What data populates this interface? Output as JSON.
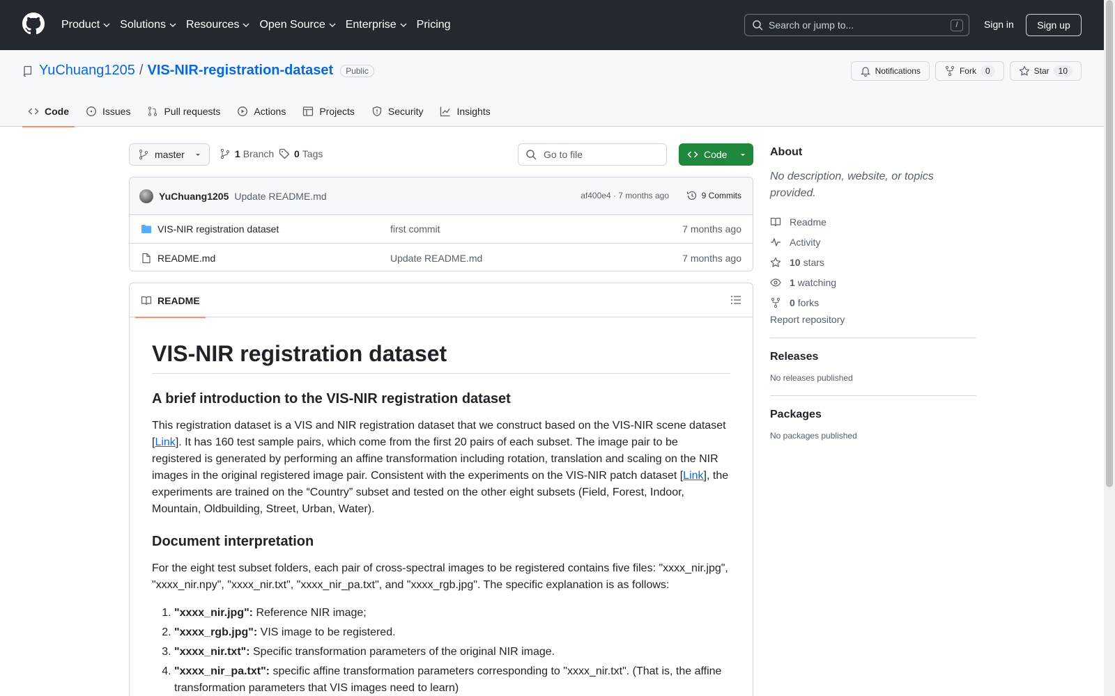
{
  "header": {
    "nav": [
      {
        "label": "Product",
        "dropdown": true
      },
      {
        "label": "Solutions",
        "dropdown": true
      },
      {
        "label": "Resources",
        "dropdown": true
      },
      {
        "label": "Open Source",
        "dropdown": true
      },
      {
        "label": "Enterprise",
        "dropdown": true
      },
      {
        "label": "Pricing",
        "dropdown": false
      }
    ],
    "search_placeholder": "Search or jump to...",
    "search_shortcut": "/",
    "signin": "Sign in",
    "signup": "Sign up"
  },
  "repo": {
    "owner": "YuChuang1205",
    "separator": "/",
    "name": "VIS-NIR-registration-dataset",
    "visibility": "Public",
    "notifications_label": "Notifications",
    "fork_label": "Fork",
    "fork_count": "0",
    "star_label": "Star",
    "star_count": "10",
    "tabs": [
      "Code",
      "Issues",
      "Pull requests",
      "Actions",
      "Projects",
      "Security",
      "Insights"
    ]
  },
  "branchbar": {
    "branch": "master",
    "branches_count": "1",
    "branches_label": "Branch",
    "tags_count": "0",
    "tags_label": "Tags",
    "goto_placeholder": "Go to file",
    "code_label": "Code"
  },
  "commit": {
    "author": "YuChuang1205",
    "message": "Update README.md",
    "meta": "af400e4 · 7 months ago",
    "count_label": "9 Commits"
  },
  "files": [
    {
      "type": "folder",
      "name": "VIS-NIR registration dataset",
      "message": "first commit",
      "date": "7 months ago"
    },
    {
      "type": "file",
      "name": "README.md",
      "message": "Update README.md",
      "date": "7 months ago"
    }
  ],
  "readme": {
    "tab_label": "README",
    "h1": "VIS-NIR registration dataset",
    "h2_intro": "A brief introduction to the VIS-NIR registration dataset",
    "p1_a": "This registration dataset is a VIS and NIR registration dataset that we construct based on the VIS-NIR scene dataset [",
    "p1_link1": "Link",
    "p1_b": "]. It has 160 test sample pairs, which come from the first 20 pairs of each subset. The image pair to be registered is generated by performing an affine transformation including rotation, translation and scaling on the NIR images in the original registered image pair. Consistent with the experiments on the VIS-NIR patch dataset [",
    "p1_link2": "Link",
    "p1_c": "], the experiments are trained on the “Country” subset and tested on the other eight subsets (Field, Forest, Indoor, Mountain, Oldbuilding, Street, Urban, Water).",
    "h2_doc": "Document interpretation",
    "p2": "For the eight test subset folders, each pair of cross-spectral images to be registered contains five files: \"xxxx_nir.jpg\", \"xxxx_nir.npy\", \"xxxx_nir.txt\", \"xxxx_nir_pa.txt\", and \"xxxx_rgb.jpg\". The specific explanation is as follows:",
    "list": [
      {
        "key": "\"xxxx_nir.jpg\":",
        "text": " Reference NIR image;"
      },
      {
        "key": "\"xxxx_rgb.jpg\":",
        "text": " VIS image to be registered."
      },
      {
        "key": "\"xxxx_nir.txt\":",
        "text": " Specific transformation parameters of the original NIR image."
      },
      {
        "key": "\"xxxx_nir_pa.txt\":",
        "text": " specific affine transformation parameters corresponding to \"xxxx_nir.txt\". (That is, the affine transformation parameters that VIS images need to learn)"
      }
    ]
  },
  "sidebar": {
    "about_title": "About",
    "about_desc": "No description, website, or topics provided.",
    "readme": "Readme",
    "activity": "Activity",
    "stars_count": "10",
    "stars_label": "stars",
    "watching_count": "1",
    "watching_label": "watching",
    "forks_count": "0",
    "forks_label": "forks",
    "report": "Report repository",
    "releases_title": "Releases",
    "releases_empty": "No releases published",
    "packages_title": "Packages",
    "packages_empty": "No packages published"
  },
  "colors": {
    "header_bg": "#24292f",
    "link": "#0969da",
    "code_button": "#1f883d",
    "active_tab_underline": "#fd8c73"
  }
}
